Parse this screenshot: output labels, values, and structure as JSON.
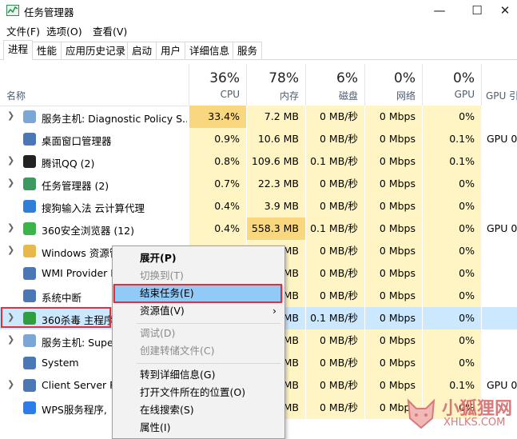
{
  "window": {
    "title": "任务管理器",
    "buttons": {
      "minimize": "—",
      "maximize": "☐",
      "close": "✕"
    }
  },
  "menubar": [
    "文件(F)",
    "选项(O)",
    "查看(V)"
  ],
  "tabs": [
    "进程",
    "性能",
    "应用历史记录",
    "启动",
    "用户",
    "详细信息",
    "服务"
  ],
  "header": {
    "name": "名称",
    "columns": [
      {
        "pct": "36%",
        "label": "CPU"
      },
      {
        "pct": "78%",
        "label": "内存"
      },
      {
        "pct": "6%",
        "label": "磁盘"
      },
      {
        "pct": "0%",
        "label": "网络"
      },
      {
        "pct": "0%",
        "label": "GPU"
      },
      {
        "pct": "",
        "label": "GPU 引"
      }
    ]
  },
  "rows": [
    {
      "name": "服务主机: Diagnostic Policy S...",
      "cpu": "33.4%",
      "mem": "7.2 MB",
      "disk": "0 MB/秒",
      "net": "0 Mbps",
      "gpu": "0%",
      "engine": "",
      "expand": true,
      "icon": "gear-icon"
    },
    {
      "name": "桌面窗口管理器",
      "cpu": "0.9%",
      "mem": "10.6 MB",
      "disk": "0 MB/秒",
      "net": "0 Mbps",
      "gpu": "0.1%",
      "engine": "GPU 0",
      "expand": false,
      "icon": "window-icon"
    },
    {
      "name": "腾讯QQ (2)",
      "cpu": "0.8%",
      "mem": "109.6 MB",
      "disk": "0.1 MB/秒",
      "net": "0 Mbps",
      "gpu": "0.1%",
      "engine": "",
      "expand": true,
      "icon": "qq-penguin-icon"
    },
    {
      "name": "任务管理器 (2)",
      "cpu": "0.7%",
      "mem": "22.3 MB",
      "disk": "0 MB/秒",
      "net": "0 Mbps",
      "gpu": "0%",
      "engine": "",
      "expand": true,
      "icon": "task-manager-icon"
    },
    {
      "name": "搜狗输入法 云计算代理",
      "cpu": "0.4%",
      "mem": "3.9 MB",
      "disk": "0 MB/秒",
      "net": "0 Mbps",
      "gpu": "0%",
      "engine": "",
      "expand": false,
      "icon": "sogou-icon"
    },
    {
      "name": "360安全浏览器 (12)",
      "cpu": "0.4%",
      "mem": "558.3 MB",
      "disk": "0.1 MB/秒",
      "net": "0 Mbps",
      "gpu": "0%",
      "engine": "GPU 0",
      "expand": true,
      "icon": "360-browser-icon"
    },
    {
      "name": "Windows 资源管",
      "cpu": "",
      "mem": "MB",
      "disk": "0 MB/秒",
      "net": "0 Mbps",
      "gpu": "0%",
      "engine": "",
      "expand": true,
      "icon": "folder-icon"
    },
    {
      "name": "WMI Provider H",
      "cpu": "",
      "mem": "MB",
      "disk": "0 MB/秒",
      "net": "0 Mbps",
      "gpu": "0%",
      "engine": "",
      "expand": false,
      "icon": "window-icon"
    },
    {
      "name": "系统中断",
      "cpu": "",
      "mem": "MB",
      "disk": "0 MB/秒",
      "net": "0 Mbps",
      "gpu": "0%",
      "engine": "",
      "expand": false,
      "icon": "window-icon"
    },
    {
      "name": "360杀毒 主程序",
      "cpu": "",
      "mem": "MB",
      "disk": "0.1 MB/秒",
      "net": "0 Mbps",
      "gpu": "0%",
      "engine": "",
      "expand": true,
      "icon": "360-antivirus-icon"
    },
    {
      "name": "服务主机: Super",
      "cpu": "",
      "mem": "MB",
      "disk": "0 MB/秒",
      "net": "0 Mbps",
      "gpu": "0%",
      "engine": "",
      "expand": true,
      "icon": "gear-icon"
    },
    {
      "name": "System",
      "cpu": "",
      "mem": "MB",
      "disk": "0 MB/秒",
      "net": "0 Mbps",
      "gpu": "0%",
      "engine": "",
      "expand": false,
      "icon": "window-icon"
    },
    {
      "name": "Client Server Ru",
      "cpu": "",
      "mem": "MB",
      "disk": "0 MB/秒",
      "net": "0 Mbps",
      "gpu": "0.1%",
      "engine": "GPU 0",
      "expand": true,
      "icon": "window-icon"
    },
    {
      "name": "WPS服务程序,",
      "cpu": "",
      "mem": "MB",
      "disk": "0 MB/秒",
      "net": "0 Mbps",
      "gpu": "0%",
      "engine": "",
      "expand": false,
      "icon": "wps-icon"
    }
  ],
  "context_menu": {
    "items": [
      "展开(P)",
      "切换到(T)",
      "结束任务(E)",
      "资源值(V)",
      "调试(D)",
      "创建转储文件(C)",
      "转到详细信息(G)",
      "打开文件所在的位置(O)",
      "在线搜索(S)",
      "属性(I)"
    ],
    "submenu_arrow": "›"
  },
  "watermark": {
    "line1": "小狐狸网",
    "line2": "XHLKS.COM"
  },
  "sort_indicator": "⌄",
  "colors": {
    "cpu_hot": "#f9d77f",
    "cell": "#fff4c4",
    "selected": "#cce8ff",
    "highlight": "#91c9f7",
    "outline": "#e0303e"
  }
}
